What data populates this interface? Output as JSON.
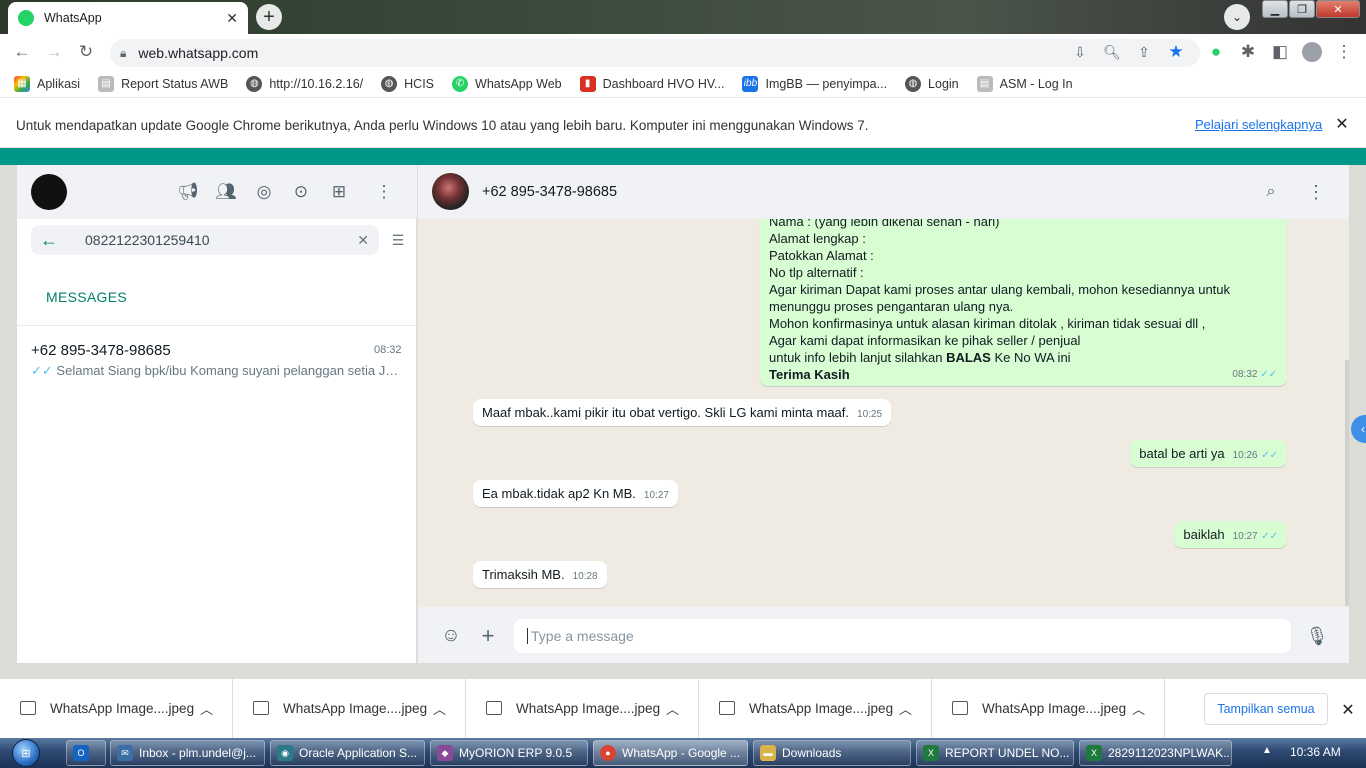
{
  "browser": {
    "tab_title": "WhatsApp",
    "url": "web.whatsapp.com",
    "bookmarks": [
      {
        "label": "Aplikasi",
        "icon": "apps-grid-icon"
      },
      {
        "label": "Report Status AWB",
        "icon": "page-icon"
      },
      {
        "label": "http://10.16.2.16/",
        "icon": "globe-icon"
      },
      {
        "label": "HCIS",
        "icon": "globe-icon"
      },
      {
        "label": "WhatsApp Web",
        "icon": "whatsapp-icon"
      },
      {
        "label": "Dashboard HVO HV...",
        "icon": "dashboard-icon"
      },
      {
        "label": "ImgBB — penyimpa...",
        "icon": "imgbb-icon"
      },
      {
        "label": "Login",
        "icon": "globe-icon"
      },
      {
        "label": "ASM - Log In",
        "icon": "page-icon"
      }
    ],
    "infobar_text": "Untuk mendapatkan update Google Chrome berikutnya, Anda perlu Windows 10 atau yang lebih baru. Komputer ini menggunakan Windows 7.",
    "infobar_link": "Pelajari selengkapnya"
  },
  "whatsapp": {
    "search_value": "0822122301259410",
    "section_label": "MESSAGES",
    "result": {
      "name": "+62 895-3478-98685",
      "time": "08:32",
      "preview": "Selamat Siang   bpk/ibu Komang suyani pelanggan setia JNE..."
    },
    "chat_name": "+62 895-3478-98685",
    "big_message": {
      "lines": [
        "Nama : (yang lebih dikenal senah - hari)",
        "Alamat  lengkap :",
        "Patokkan Alamat :",
        "No tlp alternatif :",
        "Agar kiriman Dapat kami proses antar ulang kembali, mohon kesediannya untuk",
        "menunggu proses pengantaran ulang nya.",
        "Mohon konfirmasinya untuk alasan kiriman ditolak , kiriman tidak sesuai dll ,",
        "Agar kami dapat informasikan ke pihak seller / penjual"
      ],
      "balas_prefix": "untuk info lebih lanjut silahkan ",
      "balas_bold": "BALAS",
      "balas_suffix": " Ke No WA ini",
      "closing": "Terima Kasih",
      "time": "08:32"
    },
    "messages": [
      {
        "dir": "in",
        "text": "Maaf mbak..kami pikir itu obat vertigo. Skli LG kami minta maaf.",
        "time": "10:25"
      },
      {
        "dir": "out",
        "text": "batal be arti ya",
        "time": "10:26"
      },
      {
        "dir": "in",
        "text": "Ea mbak.tidak ap2 Kn MB.",
        "time": "10:27"
      },
      {
        "dir": "out",
        "text": "baiklah",
        "time": "10:27"
      },
      {
        "dir": "in",
        "text": "Trimaksih MB.",
        "time": "10:28"
      }
    ],
    "compose_placeholder": "Type a message"
  },
  "downloads": {
    "items": [
      "WhatsApp Image....jpeg",
      "WhatsApp Image....jpeg",
      "WhatsApp Image....jpeg",
      "WhatsApp Image....jpeg",
      "WhatsApp Image....jpeg"
    ],
    "show_all": "Tampilkan semua"
  },
  "taskbar": {
    "items": [
      {
        "label": "Inbox - plm.undel@j...",
        "color": "#3a6ea5"
      },
      {
        "label": "Oracle Application S...",
        "color": "#2a7a8a"
      },
      {
        "label": "MyORION ERP 9.0.5",
        "color": "#8a4a9a"
      },
      {
        "label": "WhatsApp - Google ...",
        "color": "#d94535"
      },
      {
        "label": "Downloads",
        "color": "#d9b44a"
      },
      {
        "label": "REPORT UNDEL NO...",
        "color": "#1f7a3e"
      },
      {
        "label": "2829112023NPLWAK...",
        "color": "#1f7a3e"
      }
    ],
    "clock": "10:36 AM"
  },
  "colors": {
    "accent": "#008069",
    "outgoing_bubble": "#d9fdd3",
    "header_band": "#009688"
  }
}
